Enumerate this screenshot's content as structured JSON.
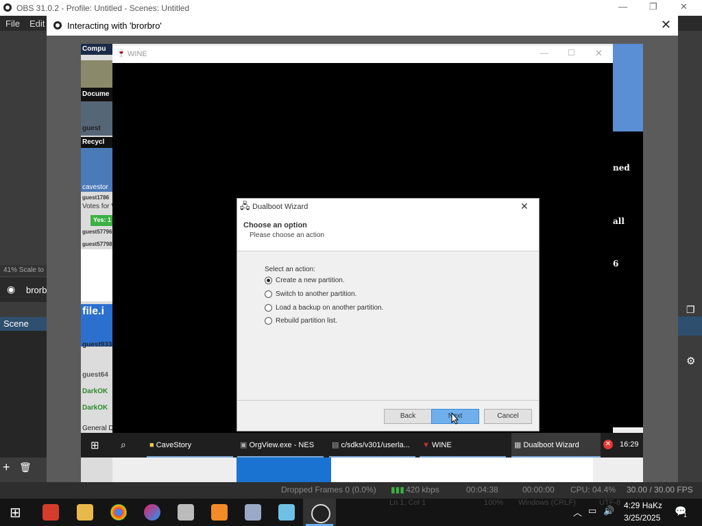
{
  "obs": {
    "title": "OBS 31.0.2 - Profile: Untitled - Scenes: Untitled",
    "menu": [
      "File",
      "Edit"
    ],
    "scale_label": "41% Scale to",
    "source_label": "brorbr",
    "scene_header": "Scene",
    "status": {
      "dropped": "Dropped Frames 0 (0.0%)",
      "kbps": "420 kbps",
      "time1": "00:04:38",
      "time2": "00:00:00",
      "cpu": "CPU: 04.4%",
      "fps": "30.00 / 30.00 FPS",
      "cursor": "Ln 1, Col 1",
      "zoom": "100%",
      "eol": "Windows (CRLF)",
      "enc": "UTF-8"
    }
  },
  "interact": {
    "title": "Interacting with 'brorbro'"
  },
  "desktop": {
    "labels": [
      "Compu",
      "Docume",
      "guest",
      "Recycl",
      "cavestor",
      "guest1786",
      "Votes for V",
      "Yes: 1",
      "guest57796",
      "guest57798",
      "file.i",
      "guest933",
      "guest64",
      "DarkOK",
      "DarkOK",
      "General Da"
    ],
    "right_labels": [
      "ned",
      "all",
      "6"
    ]
  },
  "wine": {
    "title": "WINE"
  },
  "wizard": {
    "title": "Dualboot Wizard",
    "heading": "Choose an option",
    "subheading": "Please choose an action",
    "group_label": "Select an action:",
    "options": [
      {
        "label": "Create a new partition.",
        "selected": true
      },
      {
        "label": "Switch to another partition.",
        "selected": false
      },
      {
        "label": "Load a backup on another partition.",
        "selected": false
      },
      {
        "label": "Rebuild partition list.",
        "selected": false
      }
    ],
    "buttons": {
      "back": "Back",
      "next": "Next",
      "cancel": "Cancel"
    }
  },
  "wine_taskbar": {
    "items": [
      "CaveStory",
      "OrgView.exe - NES",
      "c/sdks/v301/userla...",
      "WINE",
      "Dualboot Wizard"
    ],
    "clock": "16:29"
  },
  "taskbar": {
    "time": "4:29 HaKz",
    "date": "3/25/2025",
    "notif": "1"
  }
}
